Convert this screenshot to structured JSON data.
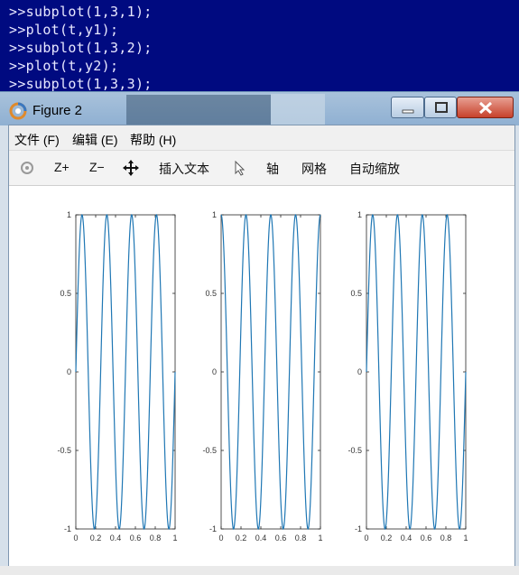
{
  "console": {
    "lines": [
      ">>subplot(1,3,1);",
      ">>plot(t,y1);",
      ">>subplot(1,3,2);",
      ">>plot(t,y2);",
      ">>subplot(1,3,3);"
    ]
  },
  "window": {
    "title": "Figure 2",
    "menu": [
      "文件 (F)",
      "编辑 (E)",
      "帮助 (H)"
    ],
    "toolbar": [
      "Z+",
      "Z−",
      "插入文本",
      "轴",
      "网格",
      "自动缩放"
    ]
  },
  "colors": {
    "console_bg": "#000a80",
    "line": "#1f77b4"
  },
  "chart_data": [
    {
      "type": "line",
      "series": [
        {
          "function": "sin(2*pi*4*t)"
        }
      ],
      "x": {
        "min": 0,
        "max": 1,
        "ticks": [
          "0",
          "0.2",
          "0.4",
          "0.6",
          "0.8",
          "1"
        ]
      },
      "y": {
        "min": -1,
        "max": 1,
        "ticks": [
          "-1",
          "-0.5",
          "0",
          "0.5",
          "1"
        ]
      }
    },
    {
      "type": "line",
      "series": [
        {
          "function": "cos(2*pi*4*t)"
        }
      ],
      "x": {
        "min": 0,
        "max": 1,
        "ticks": [
          "0",
          "0.2",
          "0.4",
          "0.6",
          "0.8",
          "1"
        ]
      },
      "y": {
        "min": -1,
        "max": 1,
        "ticks": [
          "-1",
          "-0.5",
          "0",
          "0.5",
          "1"
        ]
      }
    },
    {
      "type": "line",
      "series": [
        {
          "function": "sin(2*pi*4*t)"
        }
      ],
      "x": {
        "min": 0,
        "max": 1,
        "ticks": [
          "0",
          "0.2",
          "0.4",
          "0.6",
          "0.8",
          "1"
        ]
      },
      "y": {
        "min": -1,
        "max": 1,
        "ticks": [
          "-1",
          "-0.5",
          "0",
          "0.5",
          "1"
        ]
      }
    }
  ]
}
